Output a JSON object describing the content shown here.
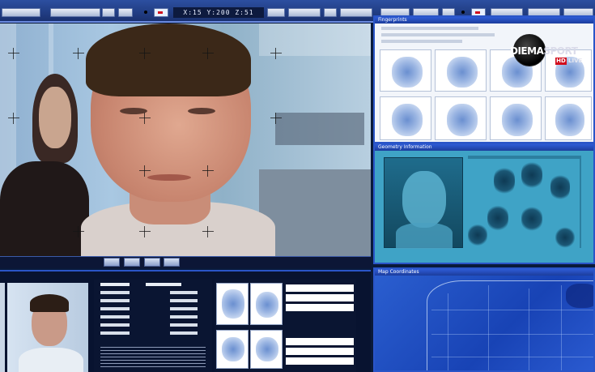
{
  "toolbar": {
    "coordinates": "X:15  Y:200  Z:51",
    "colors": {
      "background": "#1a3170",
      "record": "#d10d1d"
    }
  },
  "fingerprint_panel": {
    "title": "Fingerprints"
  },
  "geometry_panel": {
    "title": "Geometry Information"
  },
  "map_panel": {
    "title": "Map Coordinates"
  },
  "logo": {
    "brand_a": "DIEMA",
    "brand_b": "SPORT",
    "hd": "HD",
    "live": "LIVE"
  },
  "icons": [
    "record-icon",
    "crosshair-icon",
    "fingerprint-icon",
    "face-scan-icon",
    "map-icon"
  ]
}
